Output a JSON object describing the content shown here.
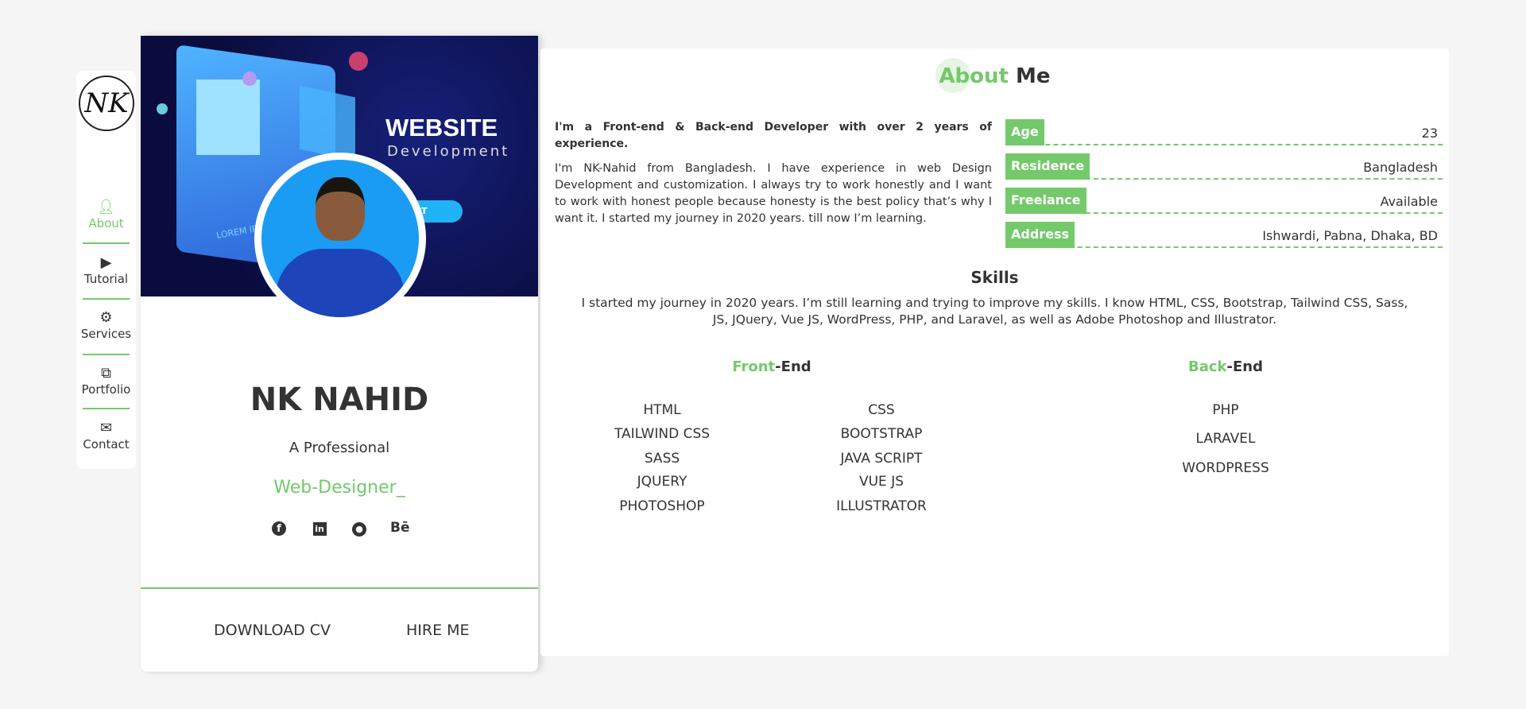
{
  "sidebar": {
    "logo": "NK",
    "items": [
      {
        "label": "About",
        "icon": "user-icon",
        "active": true
      },
      {
        "label": "Tutorial",
        "icon": "play-icon"
      },
      {
        "label": "Services",
        "icon": "gear-icon"
      },
      {
        "label": "Portfolio",
        "icon": "crop-icon"
      },
      {
        "label": "Contact",
        "icon": "envelope-open-icon"
      }
    ]
  },
  "profile": {
    "banner_title": "WEBSITE",
    "banner_subtitle": "Development",
    "banner_button": "START",
    "banner_lorem": "LOREM IPS",
    "name": "NK NAHID",
    "tagline": "A Professional",
    "role": "Web-Designer_",
    "social": [
      "facebook-icon",
      "linkedin-icon",
      "github-icon",
      "behance-icon"
    ],
    "behance_glyph": "Bē",
    "download_cv": "DOWNLOAD CV",
    "hire_me": "HIRE ME"
  },
  "about": {
    "title_accent": "About",
    "title_rest": " Me",
    "headline": "I'm a Front-end & Back-end Developer with over 2 years of experience.",
    "bio": "I'm NK-Nahid from Bangladesh. I have experience in web Design Development and customization. I always try to work honestly and I want to work with honest people because honesty is the best policy that’s why I want it. I started my journey in 2020 years. till now I’m learning.",
    "info": [
      {
        "key": "Age",
        "value": "23"
      },
      {
        "key": "Residence",
        "value": "Bangladesh"
      },
      {
        "key": "Freelance",
        "value": "Available"
      },
      {
        "key": "Address",
        "value": "Ishwardi, Pabna, Dhaka, BD"
      }
    ]
  },
  "skills": {
    "title": "Skills",
    "text": "I started my journey in 2020 years. I’m still learning and trying to improve my skills. I know HTML, CSS, Bootstrap, Tailwind CSS, Sass, JS, JQuery, Vue JS, WordPress, PHP, and Laravel, as well as Adobe Photoshop and Illustrator.",
    "front_accent": "Front",
    "front_rest": "-End",
    "back_accent": "Back",
    "back_rest": "-End",
    "front_col1": [
      "HTML",
      "TAILWIND CSS",
      "SASS",
      "JQUERY",
      "PHOTOSHOP"
    ],
    "front_col2": [
      "CSS",
      "BOOTSTRAP",
      "JAVA SCRIPT",
      "VUE JS",
      "ILLUSTRATOR"
    ],
    "back": [
      "PHP",
      "LARAVEL",
      "WORDPRESS"
    ]
  },
  "colors": {
    "accent": "#74c96b",
    "text": "#333333",
    "background": "#f5f5f5"
  }
}
